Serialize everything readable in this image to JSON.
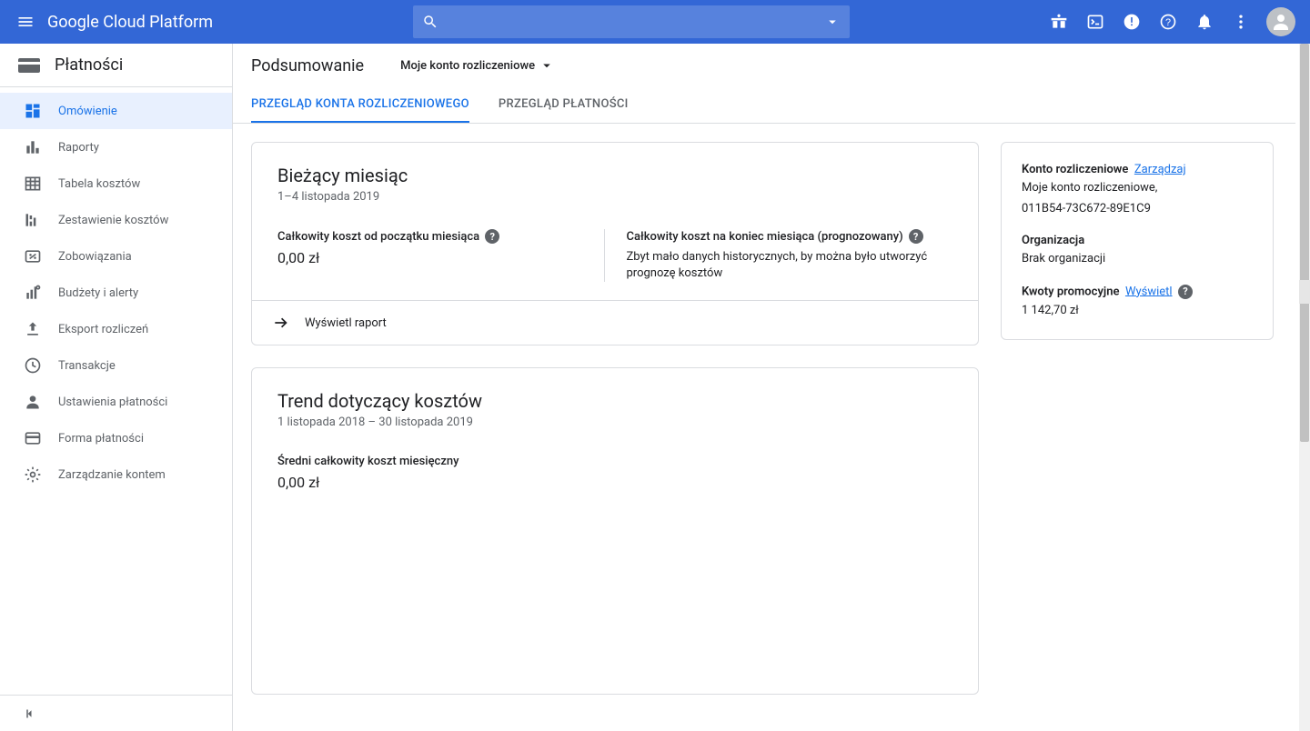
{
  "product_name": "Google Cloud Platform",
  "sidebar": {
    "title": "Płatności",
    "items": [
      {
        "label": "Omówienie",
        "icon": "dashboard",
        "active": true
      },
      {
        "label": "Raporty",
        "icon": "bar-chart"
      },
      {
        "label": "Tabela kosztów",
        "icon": "table"
      },
      {
        "label": "Zestawienie kosztów",
        "icon": "breakdown"
      },
      {
        "label": "Zobowiązania",
        "icon": "percent"
      },
      {
        "label": "Budżety i alerty",
        "icon": "budget"
      },
      {
        "label": "Eksport rozliczeń",
        "icon": "upload"
      },
      {
        "label": "Transakcje",
        "icon": "clock"
      },
      {
        "label": "Ustawienia płatności",
        "icon": "person"
      },
      {
        "label": "Forma płatności",
        "icon": "card"
      },
      {
        "label": "Zarządzanie kontem",
        "icon": "gear"
      }
    ]
  },
  "page": {
    "title": "Podsumowanie",
    "account_picker": "Moje konto rozliczeniowe",
    "tabs": [
      {
        "label": "PRZEGLĄD KONTA ROZLICZENIOWEGO",
        "active": true
      },
      {
        "label": "PRZEGLĄD PŁATNOŚCI"
      }
    ]
  },
  "card_current": {
    "title": "Bieżący miesiąc",
    "subtitle": "1–4 listopada 2019",
    "left_label": "Całkowity koszt od początku miesiąca",
    "left_value": "0,00 zł",
    "right_label": "Całkowity koszt na koniec miesiąca (prognozowany)",
    "right_note": "Zbyt mało danych historycznych, by można było utworzyć prognozę kosztów",
    "action": "Wyświetl raport"
  },
  "card_trend": {
    "title": "Trend dotyczący kosztów",
    "subtitle": "1 listopada 2018 – 30 listopada 2019",
    "avg_label": "Średni całkowity koszt miesięczny",
    "avg_value": "0,00 zł"
  },
  "side": {
    "billing_label": "Konto rozliczeniowe",
    "manage_link": "Zarządzaj",
    "account_name": "Moje konto rozliczeniowe,",
    "account_id": "011B54-73C672-89E1C9",
    "org_label": "Organizacja",
    "org_value": "Brak organizacji",
    "promo_label": "Kwoty promocyjne",
    "promo_link": "Wyświetl",
    "promo_value": "1 142,70 zł"
  }
}
